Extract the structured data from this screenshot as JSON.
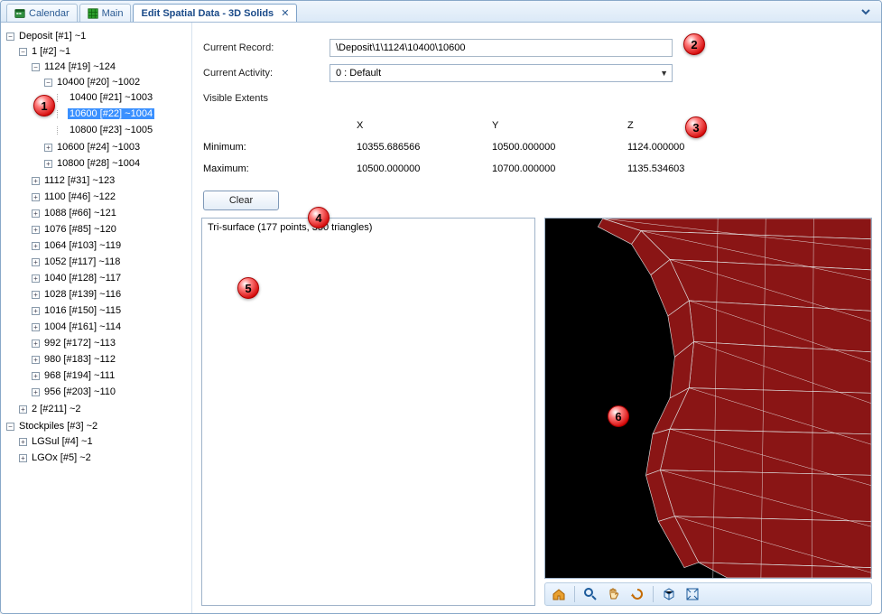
{
  "tabs": {
    "calendar": "Calendar",
    "main": "Main",
    "editor": "Edit Spatial Data - 3D Solids"
  },
  "tree": {
    "deposit": "Deposit [#1] ~1",
    "l1": "1 [#2] ~1",
    "n1124": "1124 [#19] ~124",
    "n10400p": "10400 [#20] ~1002",
    "n10400": "10400 [#21] ~1003",
    "n10600sel": "10600 [#22] ~1004",
    "n10800": "10800 [#23] ~1005",
    "n10600b": "10600 [#24] ~1003",
    "n10800b": "10800 [#28] ~1004",
    "n1112": "1112 [#31] ~123",
    "n1100": "1100 [#46] ~122",
    "n1088": "1088 [#66] ~121",
    "n1076": "1076 [#85] ~120",
    "n1064": "1064 [#103] ~119",
    "n1052": "1052 [#117] ~118",
    "n1040": "1040 [#128] ~117",
    "n1028": "1028 [#139] ~116",
    "n1016": "1016 [#150] ~115",
    "n1004": "1004 [#161] ~114",
    "n992": "992 [#172] ~113",
    "n980": "980 [#183] ~112",
    "n968": "968 [#194] ~111",
    "n956": "956 [#203] ~110",
    "l2": "2 [#211] ~2",
    "stock": "Stockpiles [#3] ~2",
    "lgsul": "LGSul [#4] ~1",
    "lgox": "LGOx [#5] ~2"
  },
  "form": {
    "current_record_lbl": "Current Record:",
    "current_record_val": "\\Deposit\\1\\1124\\10400\\10600",
    "current_activity_lbl": "Current Activity:",
    "current_activity_val": "0 : Default",
    "visible_extents_lbl": "Visible Extents",
    "hX": "X",
    "hY": "Y",
    "hZ": "Z",
    "min_lbl": "Minimum:",
    "min_x": "10355.686566",
    "min_y": "10500.000000",
    "min_z": "1124.000000",
    "max_lbl": "Maximum:",
    "max_x": "10500.000000",
    "max_y": "10700.000000",
    "max_z": "1135.534603",
    "clear_btn": "Clear"
  },
  "list": {
    "line0": "Tri-surface (177 points, 350 triangles)"
  },
  "toolbar_icons": {
    "home": "house-icon",
    "zoom": "magnifier-icon",
    "pan": "hand-icon",
    "rotate": "rotate-icon",
    "box": "box-icon",
    "fit": "fit-icon"
  },
  "callouts": {
    "c1": "1",
    "c2": "2",
    "c3": "3",
    "c4": "4",
    "c5": "5",
    "c6": "6"
  }
}
